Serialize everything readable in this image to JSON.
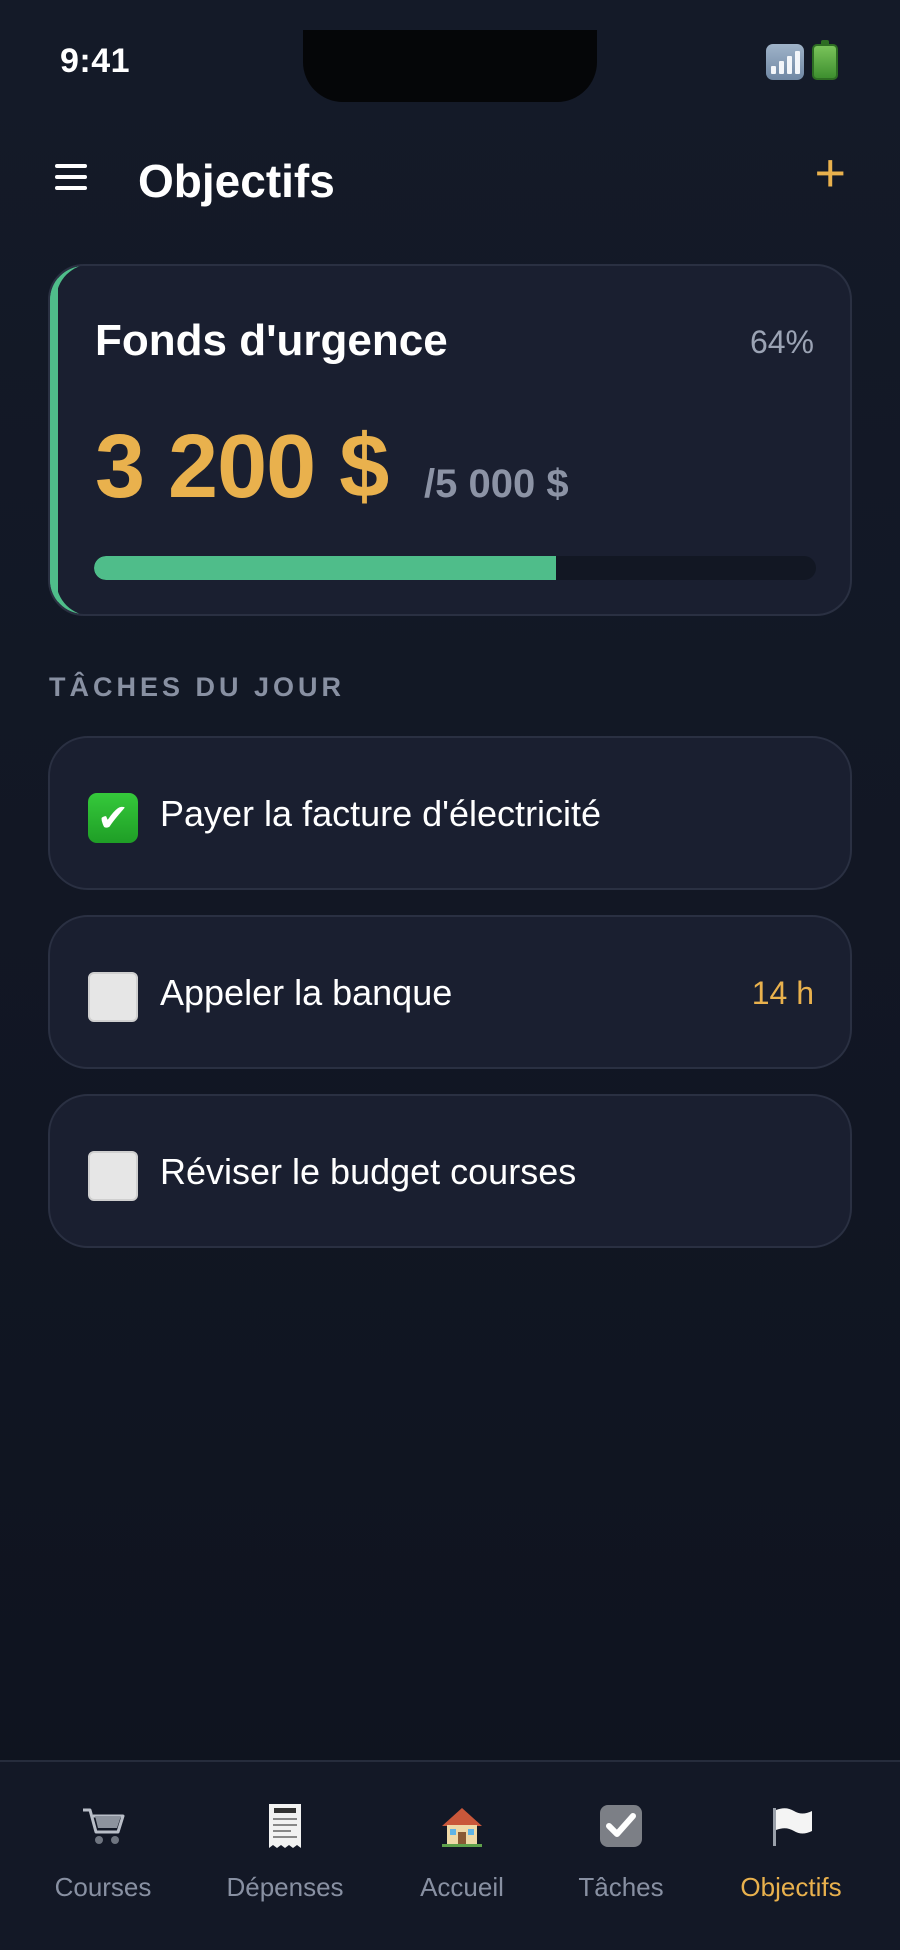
{
  "status_bar": {
    "time": "9:41",
    "signal_icon": "signal-icon",
    "battery_icon": "battery-icon"
  },
  "header": {
    "title": "Objectifs",
    "menu_icon": "menu-icon",
    "add_label": "+"
  },
  "goal": {
    "title": "Fonds d'urgence",
    "percent_label": "64%",
    "current": "3 200 $",
    "target": "/5 000 $",
    "progress": 0.64,
    "accent_color": "#4fbd8a",
    "amount_color": "#e9b14d"
  },
  "section": {
    "label": "TÂCHES DU JOUR"
  },
  "tasks": [
    {
      "label": "Payer la facture d'électricité",
      "done": true,
      "time": ""
    },
    {
      "label": "Appeler la banque",
      "done": false,
      "time": "14 h"
    },
    {
      "label": "Réviser le budget courses",
      "done": false,
      "time": ""
    }
  ],
  "tabbar": {
    "items": [
      {
        "label": "Courses",
        "icon": "shopping-cart-icon",
        "active": false
      },
      {
        "label": "Dépenses",
        "icon": "receipt-icon",
        "active": false
      },
      {
        "label": "Accueil",
        "icon": "house-icon",
        "active": false
      },
      {
        "label": "Tâches",
        "icon": "check-box-icon",
        "active": false
      },
      {
        "label": "Objectifs",
        "icon": "flag-icon",
        "active": true
      }
    ]
  }
}
